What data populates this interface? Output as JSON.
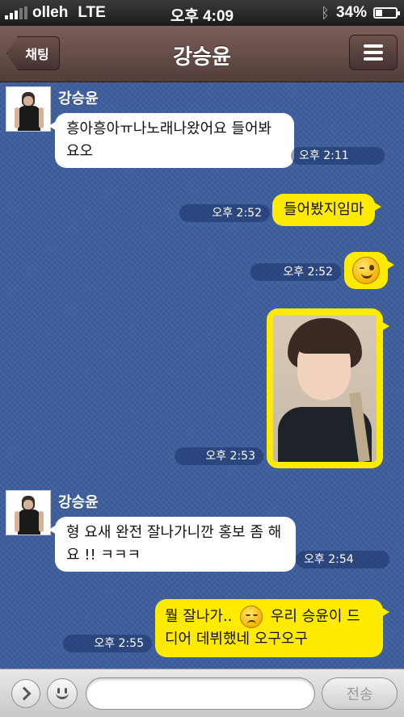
{
  "status_bar": {
    "carrier": "olleh",
    "network": "LTE",
    "time": "오후 4:09",
    "battery": "34%",
    "battery_level": 0.34
  },
  "nav": {
    "back_label": "채팅",
    "title": "강승윤",
    "menu_icon": "hamburger-icon"
  },
  "messages": [
    {
      "sender": "강승윤",
      "type": "text",
      "text": "흥아흥아ㅠ나노래나왔어요 들어봐요오",
      "time": "오후 2:11"
    },
    {
      "type": "text",
      "text": "들어봤지임마",
      "time": "오후 2:52"
    },
    {
      "type": "emoticon",
      "icon": "wink-face-icon",
      "time": "오후 2:52"
    },
    {
      "type": "photo",
      "icon": "photo-icon",
      "time": "오후 2:53"
    },
    {
      "sender": "강승윤",
      "type": "text",
      "text": "형 요새 완전 잘나가니깐 홍보 좀 해요 !! ㅋㅋㅋ",
      "time": "오후 2:54"
    },
    {
      "type": "text",
      "text_a": "뭘 잘나가..",
      "emoji": "sad-face-icon",
      "text_b": "우리 승윤이 드디어 데뷔했네 오구오구",
      "time": "오후 2:55"
    }
  ],
  "input_bar": {
    "send_label": "전송",
    "placeholder": ""
  },
  "colors": {
    "chat_background": "#3e5f9d",
    "my_bubble": "#ffea00",
    "their_bubble": "#ffffff",
    "nav_bar": "#6a504b"
  }
}
